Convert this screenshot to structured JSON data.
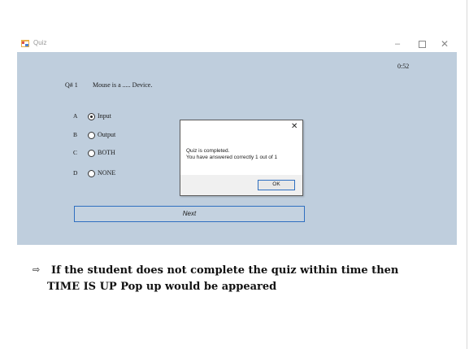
{
  "window": {
    "title": "Quiz",
    "icon": "form-icon",
    "controls": {
      "minimize": "–",
      "maximize": "",
      "close": "✕"
    }
  },
  "quiz": {
    "timer": "0:52",
    "question_number": "Q# 1",
    "question_text": "Mouse is a ..... Device.",
    "options": [
      {
        "letter": "A",
        "label": "Input",
        "selected": true
      },
      {
        "letter": "B",
        "label": "Output",
        "selected": false
      },
      {
        "letter": "C",
        "label": "BOTH",
        "selected": false
      },
      {
        "letter": "D",
        "label": "NONE",
        "selected": false
      }
    ],
    "next_label": "Next"
  },
  "message_box": {
    "close": "✕",
    "line1": "Quiz is completed.",
    "line2": "You have answered correctly 1 out of 1",
    "ok_label": "OK"
  },
  "note": {
    "arrow": "⇨",
    "line1": "If the student does not complete the quiz within time then",
    "line2": "TIME IS UP Pop up would be appeared"
  },
  "colors": {
    "client_background": "#bfcedd",
    "button_border": "#2f6fc0"
  }
}
